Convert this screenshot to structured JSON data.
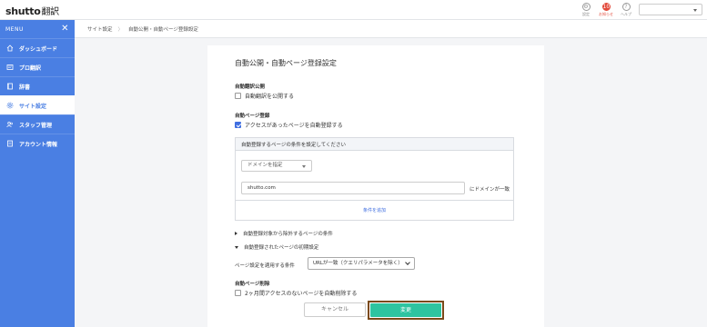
{
  "app": {
    "logo_brand": "shutto",
    "logo_jp": "翻訳"
  },
  "topbar": {
    "icons": [
      {
        "name": "settings-icon",
        "label": "設定"
      },
      {
        "name": "notice-icon",
        "label": "お知らせ",
        "badge": "10"
      },
      {
        "name": "help-icon",
        "label": "ヘルプ"
      }
    ],
    "select_value": ""
  },
  "sidebar": {
    "menu_label": "MENU",
    "close_glyph": "✕",
    "items": [
      {
        "label": "ダッシュボード",
        "icon": "home-icon",
        "active": false
      },
      {
        "label": "プロ翻訳",
        "icon": "pro-translate-icon",
        "active": false
      },
      {
        "label": "辞書",
        "icon": "dictionary-icon",
        "active": false
      },
      {
        "label": "サイト設定",
        "icon": "gear-icon",
        "active": true
      },
      {
        "label": "スタッフ管理",
        "icon": "staff-icon",
        "active": false
      },
      {
        "label": "アカウント情報",
        "icon": "account-icon",
        "active": false
      }
    ]
  },
  "breadcrumb": {
    "items": [
      "サイト設定",
      "自動公開・自動ページ登録設定"
    ],
    "sep": "〉"
  },
  "main": {
    "title": "自動公開・自動ページ登録設定",
    "auto_publish": {
      "heading": "自動翻訳公開",
      "checkbox_label": "自動翻訳を公開する",
      "checked": false
    },
    "auto_register": {
      "heading": "自動ページ登録",
      "checkbox_label": "アクセスがあったページを自動登録する",
      "checked": true
    },
    "condition_box": {
      "heading": "自動登録するページの条件を設定してください",
      "domain_select": "ドメインを指定",
      "domain_value": "shutto.com",
      "suffix": "にドメインが一致",
      "add_condition": "条件を追加"
    },
    "exclude_toggle": "自動登録対象から除外するページの条件",
    "initial_toggle": "自動登録されたページの初期設定",
    "page_setting": {
      "label": "ページ設定を適用する条件",
      "select_value": "URLが一致（クエリパラメータを除く）"
    },
    "auto_delete": {
      "heading": "自動ページ削除",
      "checkbox_label": "2ヶ月間アクセスのないページを自動削除する",
      "checked": false
    },
    "buttons": {
      "cancel": "キャンセル",
      "save": "変更"
    }
  }
}
